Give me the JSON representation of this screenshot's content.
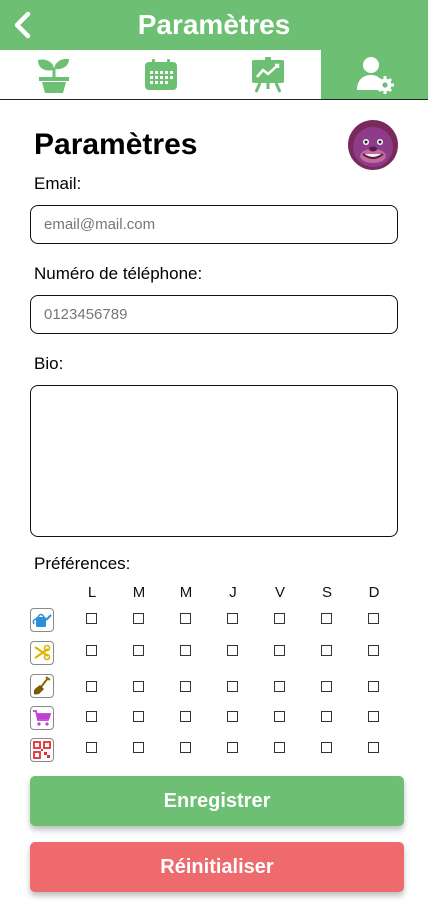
{
  "header": {
    "title": "Paramètres"
  },
  "tabs": [
    {
      "icon": "plant-pot-icon",
      "active": false
    },
    {
      "icon": "calendar-icon",
      "active": false
    },
    {
      "icon": "chart-board-icon",
      "active": false
    },
    {
      "icon": "user-settings-icon",
      "active": true
    }
  ],
  "form": {
    "title": "Paramètres",
    "email_label": "Email:",
    "email_placeholder": "email@mail.com",
    "phone_label": "Numéro de téléphone:",
    "phone_placeholder": "0123456789",
    "bio_label": "Bio:",
    "bio_value": ""
  },
  "preferences": {
    "label": "Préférences:",
    "days": [
      "L",
      "M",
      "M",
      "J",
      "V",
      "S",
      "D"
    ],
    "rows": [
      {
        "icon": "watering-can-icon",
        "checked": [
          false,
          false,
          false,
          false,
          false,
          false,
          false
        ]
      },
      {
        "icon": "pruning-shears-icon",
        "checked": [
          false,
          false,
          false,
          false,
          false,
          false,
          false
        ]
      },
      {
        "icon": "shovel-icon",
        "checked": [
          false,
          false,
          false,
          false,
          false,
          false,
          false
        ]
      },
      {
        "icon": "shopping-cart-icon",
        "checked": [
          false,
          false,
          false,
          false,
          false,
          false,
          false
        ]
      },
      {
        "icon": "qr-code-icon",
        "checked": [
          false,
          false,
          false,
          false,
          false,
          false,
          false
        ]
      }
    ]
  },
  "buttons": {
    "save": "Enregistrer",
    "reset": "Réinitialiser"
  },
  "colors": {
    "primary": "#6cbf73",
    "danger": "#ee6a6c"
  }
}
